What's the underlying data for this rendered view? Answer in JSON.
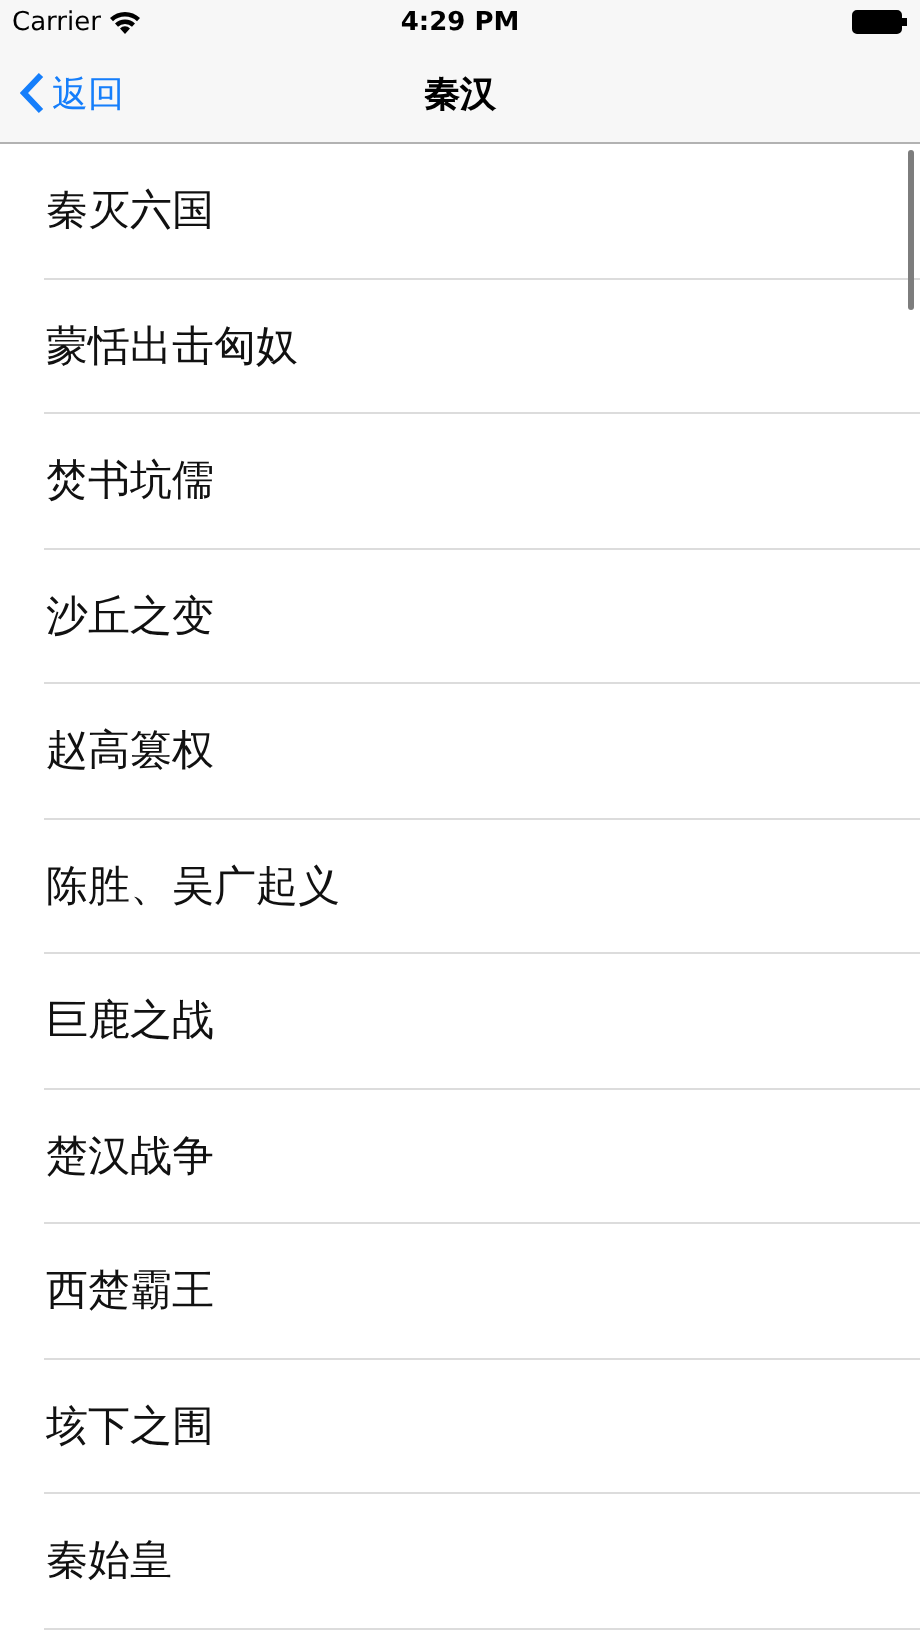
{
  "status_bar": {
    "carrier": "Carrier",
    "time": "4:29 PM"
  },
  "nav_bar": {
    "back_label": "返回",
    "title": "秦汉"
  },
  "list": {
    "items": [
      {
        "label": "秦灭六国"
      },
      {
        "label": "蒙恬出击匈奴"
      },
      {
        "label": "焚书坑儒"
      },
      {
        "label": "沙丘之变"
      },
      {
        "label": "赵高篡权"
      },
      {
        "label": "陈胜、吴广起义"
      },
      {
        "label": "巨鹿之战"
      },
      {
        "label": "楚汉战争"
      },
      {
        "label": "西楚霸王"
      },
      {
        "label": "垓下之围"
      },
      {
        "label": "秦始皇"
      }
    ]
  }
}
